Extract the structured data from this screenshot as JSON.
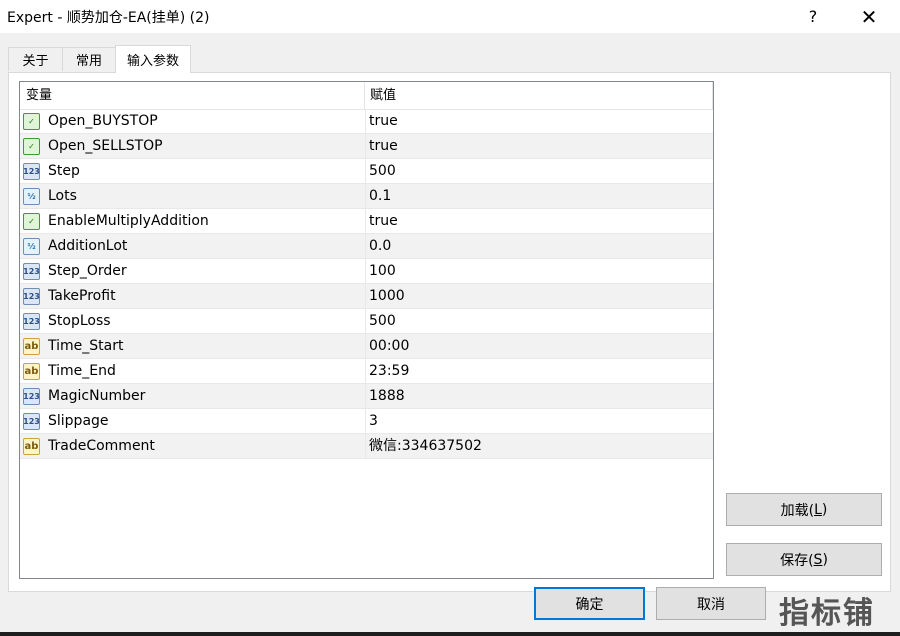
{
  "window": {
    "title": "Expert - 顺势加仓-EA(挂单) (2)",
    "help_label": "?",
    "close_label": "✕"
  },
  "tabs": [
    {
      "label": "关于",
      "active": false
    },
    {
      "label": "常用",
      "active": false
    },
    {
      "label": "输入参数",
      "active": true
    }
  ],
  "table": {
    "headers": {
      "variable": "变量",
      "value": "赋值"
    },
    "rows": [
      {
        "icon": "bool-icon",
        "name": "Open_BUYSTOP",
        "value": "true"
      },
      {
        "icon": "bool-icon",
        "name": "Open_SELLSTOP",
        "value": "true"
      },
      {
        "icon": "int-icon",
        "name": "Step",
        "value": "500"
      },
      {
        "icon": "double-icon",
        "name": "Lots",
        "value": "0.1"
      },
      {
        "icon": "bool-icon",
        "name": "EnableMultiplyAddition",
        "value": "true"
      },
      {
        "icon": "double-icon",
        "name": "AdditionLot",
        "value": "0.0"
      },
      {
        "icon": "int-icon",
        "name": "Step_Order",
        "value": "100"
      },
      {
        "icon": "int-icon",
        "name": "TakeProfit",
        "value": "1000"
      },
      {
        "icon": "int-icon",
        "name": "StopLoss",
        "value": "500"
      },
      {
        "icon": "string-icon",
        "name": "Time_Start",
        "value": "00:00"
      },
      {
        "icon": "string-icon",
        "name": "Time_End",
        "value": "23:59"
      },
      {
        "icon": "int-icon",
        "name": "MagicNumber",
        "value": "1888"
      },
      {
        "icon": "int-icon",
        "name": "Slippage",
        "value": "3"
      },
      {
        "icon": "string-icon",
        "name": "TradeComment",
        "value": "微信:334637502"
      }
    ]
  },
  "buttons": {
    "load": {
      "text": "加载(",
      "key": "L",
      "end": ")"
    },
    "save": {
      "text": "保存(",
      "key": "S",
      "end": ")"
    },
    "ok": "确定",
    "cancel": "取消"
  },
  "icon_glyphs": {
    "bool-icon": "✓",
    "int-icon": "123",
    "double-icon": "½",
    "string-icon": "ab"
  },
  "watermark": "指标铺"
}
